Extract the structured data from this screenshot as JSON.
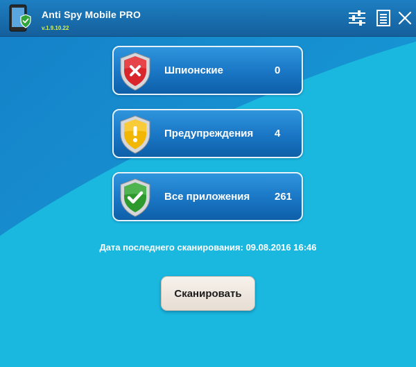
{
  "app": {
    "title": "Anti Spy Mobile PRO",
    "version": "v.1.9.10.22"
  },
  "toolbar": {
    "settings_icon": "sliders-icon",
    "log_icon": "document-icon",
    "close_icon": "close-icon"
  },
  "cards": [
    {
      "label": "Шпионские",
      "count": "0",
      "icon": "red-shield-x-icon",
      "color": "#d9262c"
    },
    {
      "label": "Предупреждения",
      "count": "4",
      "icon": "yellow-shield-exclamation-icon",
      "color": "#f2b705"
    },
    {
      "label": "Все приложения",
      "count": "261",
      "icon": "green-shield-check-icon",
      "color": "#2e9a2e"
    }
  ],
  "last_scan": {
    "text": "Дата последнего сканирования: 09.08.2016 16:46"
  },
  "scan_button": {
    "label": "Сканировать"
  },
  "colors": {
    "titlebar": "#1a6fb0",
    "background_dark": "#168fd0",
    "background_light": "#1bb6df",
    "version_text": "#d8f24a"
  }
}
